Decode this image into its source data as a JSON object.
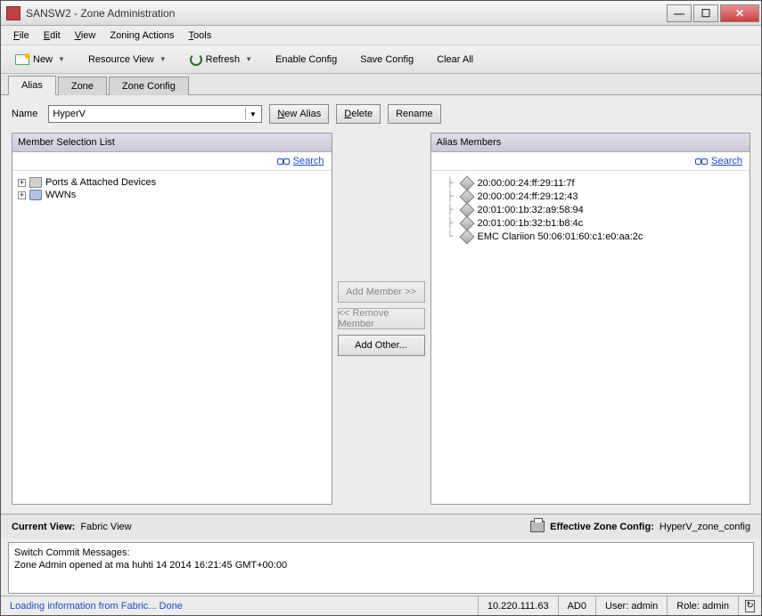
{
  "window": {
    "title": "SANSW2 - Zone Administration"
  },
  "menu": {
    "file": "File",
    "edit": "Edit",
    "view": "View",
    "zoning": "Zoning Actions",
    "tools": "Tools"
  },
  "toolbar": {
    "new": "New",
    "resource_view": "Resource View",
    "refresh": "Refresh",
    "enable": "Enable Config",
    "save": "Save Config",
    "clear": "Clear All"
  },
  "tabs": [
    {
      "label": "Alias",
      "active": true
    },
    {
      "label": "Zone",
      "active": false
    },
    {
      "label": "Zone Config",
      "active": false
    }
  ],
  "name_row": {
    "label": "Name",
    "value": "HyperV",
    "new_alias": "New Alias",
    "delete": "Delete",
    "rename": "Rename"
  },
  "left_panel": {
    "title": "Member Selection List",
    "search": "Search",
    "nodes": [
      {
        "label": "Ports & Attached Devices",
        "icon": "ports"
      },
      {
        "label": "WWNs",
        "icon": "wwn"
      }
    ]
  },
  "mid_buttons": {
    "add": "Add Member >>",
    "remove": "<< Remove Member",
    "other": "Add Other..."
  },
  "right_panel": {
    "title": "Alias Members",
    "search": "Search",
    "members": [
      "20:00:00:24:ff:29:11:7f",
      "20:00:00:24:ff:29:12:43",
      "20:01:00:1b:32:a9:58:94",
      "20:01:00:1b:32:b1:b8:4c",
      "EMC Clariion 50:06:01:60:c1:e0:aa:2c"
    ]
  },
  "viewbar": {
    "current_label": "Current View:",
    "current_value": "Fabric View",
    "eff_label": "Effective Zone Config:",
    "eff_value": "HyperV_zone_config"
  },
  "commit": {
    "header": "Switch Commit Messages:",
    "lines": [
      "Zone Admin opened at ma huhti 14 2014 16:21:45 GMT+00:00"
    ]
  },
  "status": {
    "loading": "Loading information from Fabric... Done",
    "ip": "10.220.111.63",
    "ad": "AD0",
    "user": "User: admin",
    "role": "Role: admin"
  }
}
